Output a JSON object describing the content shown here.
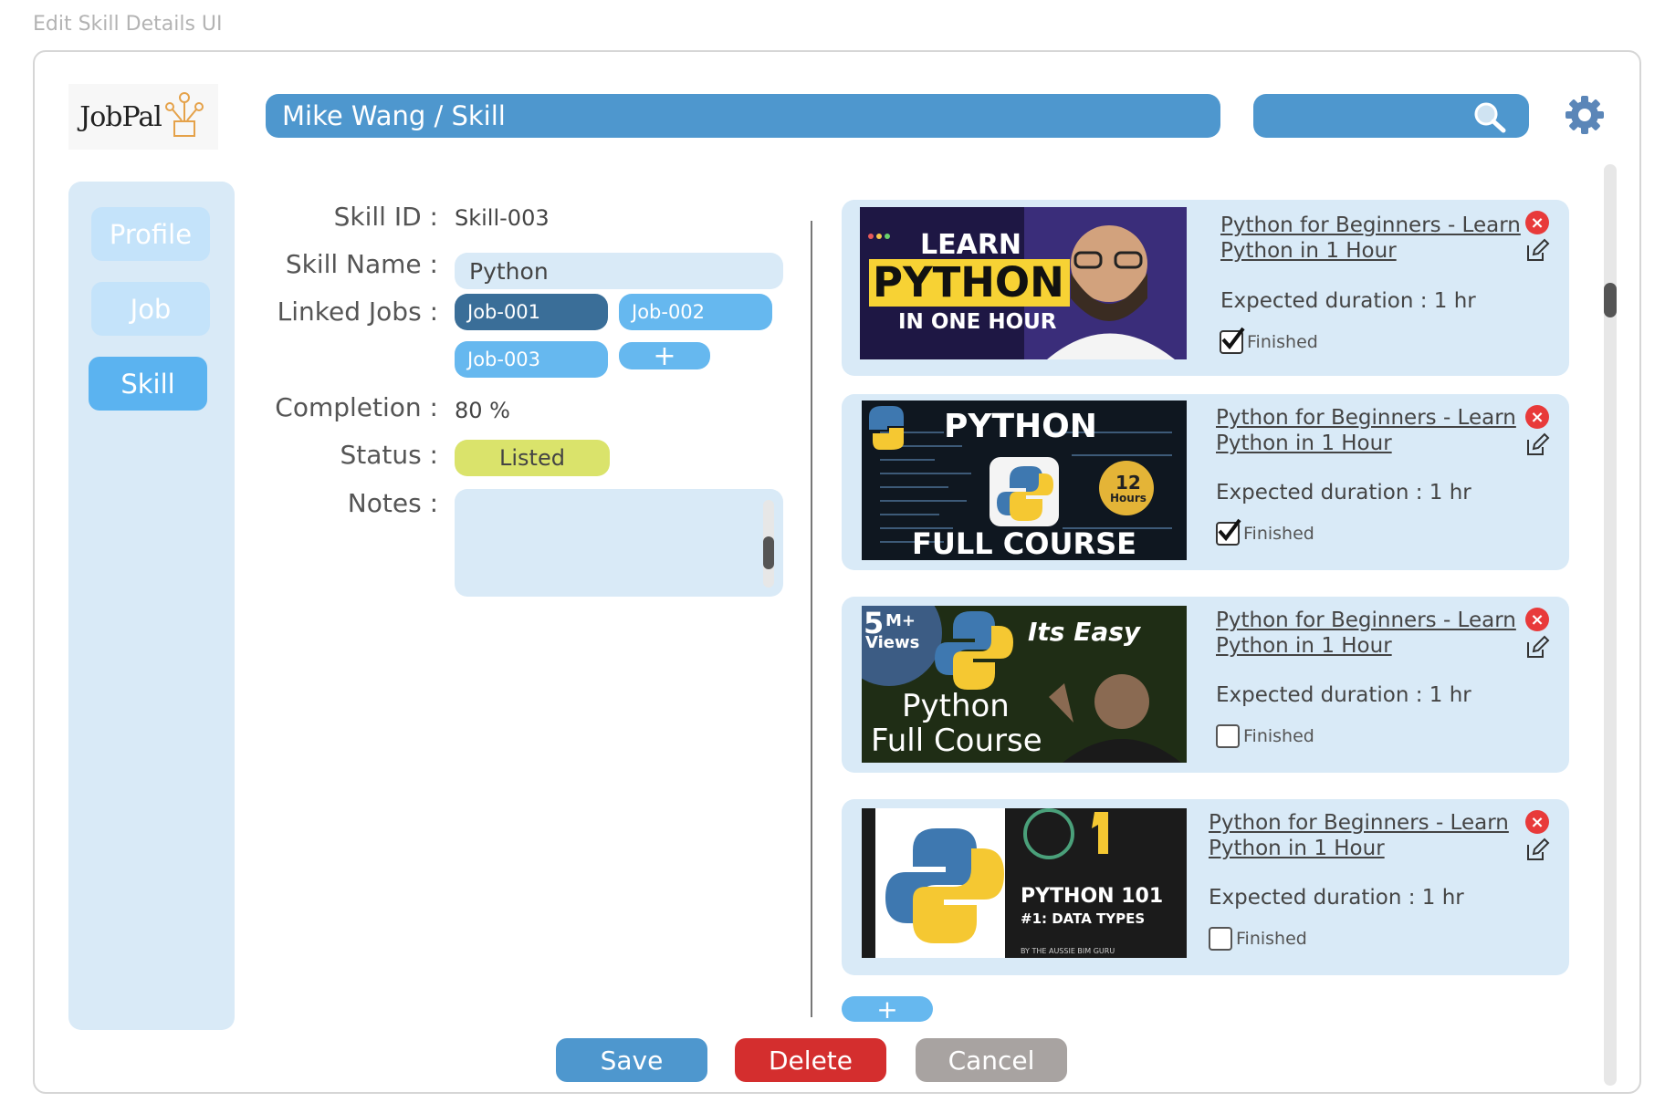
{
  "page_caption": "Edit Skill Details UI",
  "logo": {
    "text": "JobPal"
  },
  "header": {
    "breadcrumb": "Mike Wang / Skill",
    "search_placeholder": ""
  },
  "sidebar": {
    "items": [
      {
        "label": "Profile"
      },
      {
        "label": "Job"
      },
      {
        "label": "Skill"
      }
    ],
    "active": "Skill"
  },
  "form": {
    "skill_id_label": "Skill ID :",
    "skill_id_value": "Skill-003",
    "skill_name_label": "Skill Name :",
    "skill_name_value": "Python",
    "linked_jobs_label": "Linked Jobs :",
    "linked_jobs": [
      "Job-001",
      "Job-002",
      "Job-003"
    ],
    "completion_label": "Completion :",
    "completion_value": "80 %",
    "status_label": "Status :",
    "status_value": "Listed",
    "notes_label": "Notes :",
    "notes_value": ""
  },
  "videos": [
    {
      "title": "Python for Beginners - Learn Python in 1 Hour",
      "duration": "Expected duration : 1 hr",
      "finished_label": "Finished",
      "finished": true,
      "thumb": {
        "line1": "LEARN",
        "line2": "PYTHON",
        "line3": "IN ONE HOUR"
      }
    },
    {
      "title": "Python for Beginners - Learn Python in 1 Hour",
      "duration": "Expected duration : 1 hr",
      "finished_label": "Finished",
      "finished": true,
      "thumb": {
        "line1": "PYTHON",
        "line2": "FULL COURSE",
        "badge_num": "12",
        "badge_unit": "Hours"
      }
    },
    {
      "title": "Python for Beginners - Learn Python in 1 Hour",
      "duration": "Expected duration : 1 hr",
      "finished_label": "Finished",
      "finished": false,
      "thumb": {
        "views_num": "5",
        "views_plus": "M+",
        "views": "Views",
        "easy": "Its Easy",
        "line1": "Python",
        "line2": "Full Course"
      }
    },
    {
      "title": "Python for Beginners - Learn Python in 1 Hour",
      "duration": "Expected duration : 1 hr",
      "finished_label": "Finished",
      "finished": false,
      "thumb": {
        "num": "1",
        "line1": "PYTHON 101",
        "line2": "#1: DATA TYPES",
        "credit": "BY THE AUSSIE BIM GURU"
      }
    }
  ],
  "buttons": {
    "save": "Save",
    "delete": "Delete",
    "cancel": "Cancel"
  },
  "colors": {
    "primary": "#4e97ce",
    "light_panel": "#d9eaf7",
    "accent": "#66b8ef",
    "delete": "#d42e2e",
    "cancel": "#a8a3a1",
    "status": "#dae36b"
  }
}
